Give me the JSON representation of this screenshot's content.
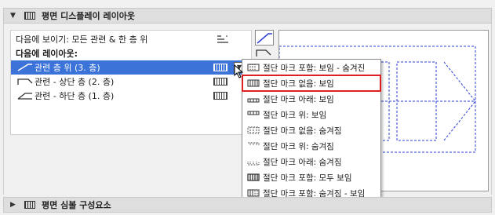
{
  "top_section": {
    "title": "평면 디스플레이 레이아웃"
  },
  "list": {
    "header_row": "다음에 보이기: 모든 관련 & 한 층 위",
    "layout_label": "다음에 레이아웃:",
    "rows": [
      {
        "label": "관련 층 위 (3. 층)"
      },
      {
        "label": "관련 - 상단 층 (2. 층)"
      },
      {
        "label": "관련 - 하단 층 (1. 층)"
      }
    ]
  },
  "menu": {
    "items": [
      {
        "label": "절단 마크 포함: 보임 - 숨겨진"
      },
      {
        "label": "절단 마크 없음: 보임"
      },
      {
        "label": "절단 마크 아래: 보임"
      },
      {
        "label": "절단 마크 위: 보임"
      },
      {
        "label": "절단 마크 없음: 숨겨짐"
      },
      {
        "label": "절단 마크 위: 숨겨짐"
      },
      {
        "label": "절단 마크 아래: 숨겨짐"
      },
      {
        "label": "절단 마크 포함: 모두 보임"
      },
      {
        "label": "절단 마크 포함: 숨겨짐 - 보임"
      }
    ]
  },
  "bottom_section": {
    "title": "평면 심볼 구성요소"
  },
  "colors": {
    "selection": "#3b73d9",
    "highlight": "#e02020",
    "preview_lines": "#2b3fd6"
  },
  "icons": {
    "collapse": "triangle-down",
    "expand": "triangle-right",
    "section": "floor-plan-icon"
  }
}
